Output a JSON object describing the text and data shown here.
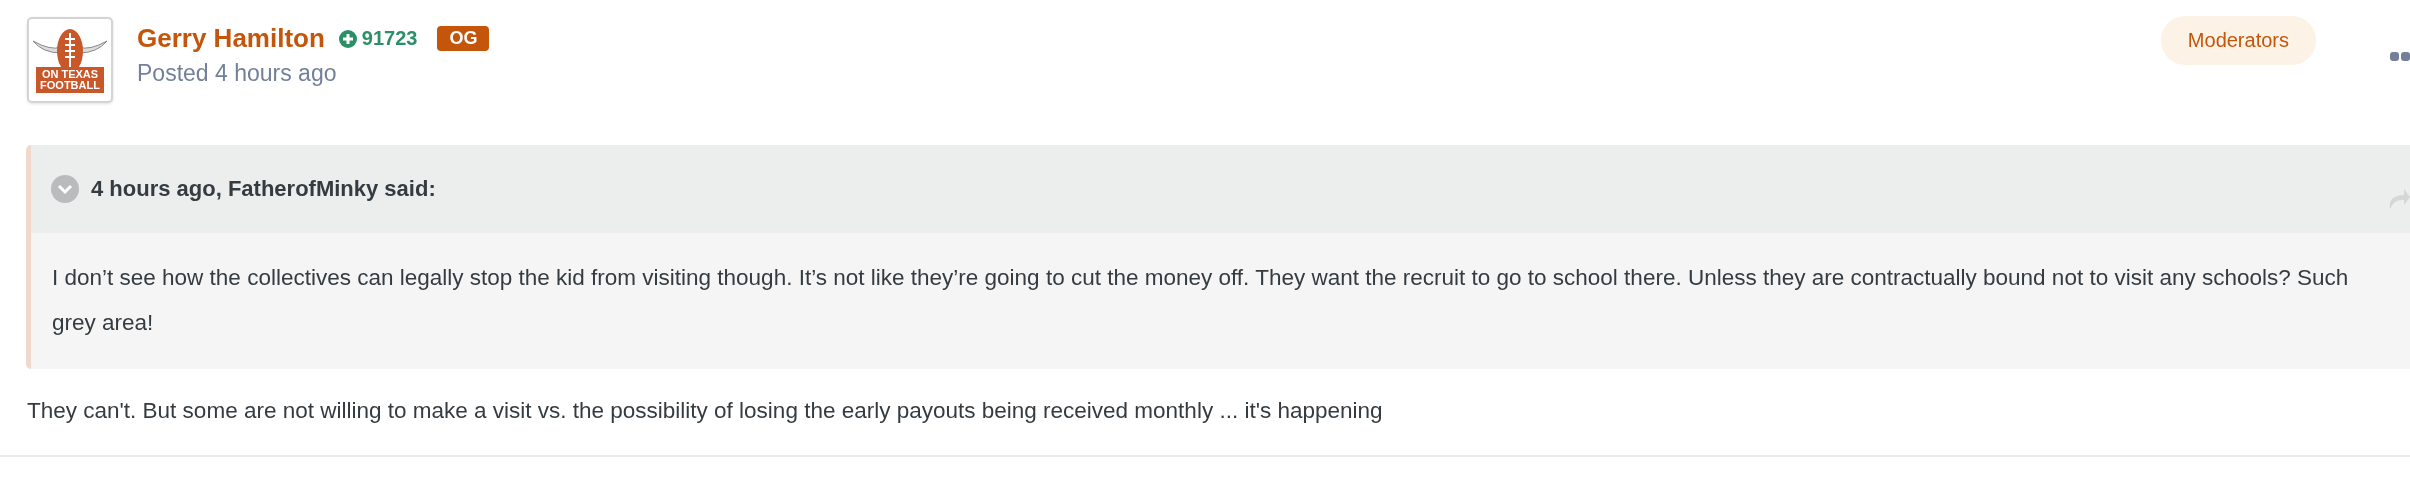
{
  "post": {
    "author": {
      "name": "Gerry Hamilton",
      "reputation": "91723",
      "badge": "OG",
      "avatar_lines": [
        "ON TEXAS",
        "FOOTBALL"
      ]
    },
    "posted": "Posted 4 hours ago",
    "group": "Moderators",
    "quote": {
      "expanded": true,
      "citation": "4 hours ago, FatherofMinky said:",
      "text": "I don’t see how the collectives can legally stop the kid from visiting though. It’s not like they’re going to cut the money off. They want the recruit to go to school there. Unless they are contractually bound not to visit any schools? Such grey area!"
    },
    "body": "They can't. But some are not willing to make a visit vs. the possibility of losing the early payouts being received monthly ... it's happening"
  }
}
